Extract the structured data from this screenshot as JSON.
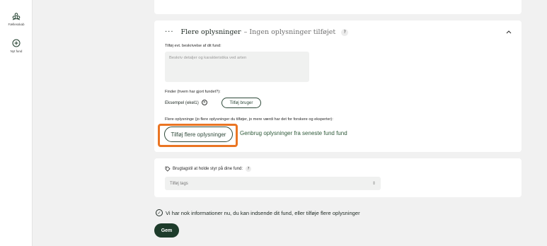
{
  "sidebar": {
    "items": [
      {
        "label": "Fællesskab",
        "icon": "community-icon"
      },
      {
        "label": "Nyt fund",
        "icon": "plus-circle-icon"
      }
    ]
  },
  "more_info": {
    "dots": "···",
    "title": "Flere oplysninger",
    "subtitle": "– Ingen oplysninger tilføjet",
    "help": "?",
    "collapse_icon": "chevron-up-icon",
    "description_label": "Tilføj evt. beskrivelse af dit fund:",
    "description_placeholder": "Beskriv detaljer og karakteristika ved arten",
    "finder_label": "Finder (hvem har gjort fundet?):",
    "finder_value": "Eksempel (ekel1)",
    "finder_remove": "⊗",
    "add_user_label": "Tilføj bruger",
    "more_label": "Flere oplysninge (jo flere oplysninger du tilføjer, jo mere værdi har det for forskere og eksperter):",
    "add_more_label": "Tilføj flere oplysninger",
    "reuse_label": "Genbrug oplysninger fra seneste fund fund"
  },
  "tags": {
    "label": "Brugtagstil at holde styr på dine fund:",
    "help": "?",
    "placeholder": "Tilføj tags"
  },
  "footer": {
    "done_text": "Vi har nok informationer nu, du kan indsende dit fund, eller tilføje flere oplysninger",
    "save_label": "Gem"
  },
  "colors": {
    "accent_dark": "#1d3b2a",
    "highlight": "#ea7523",
    "link": "#2f5a3a"
  }
}
